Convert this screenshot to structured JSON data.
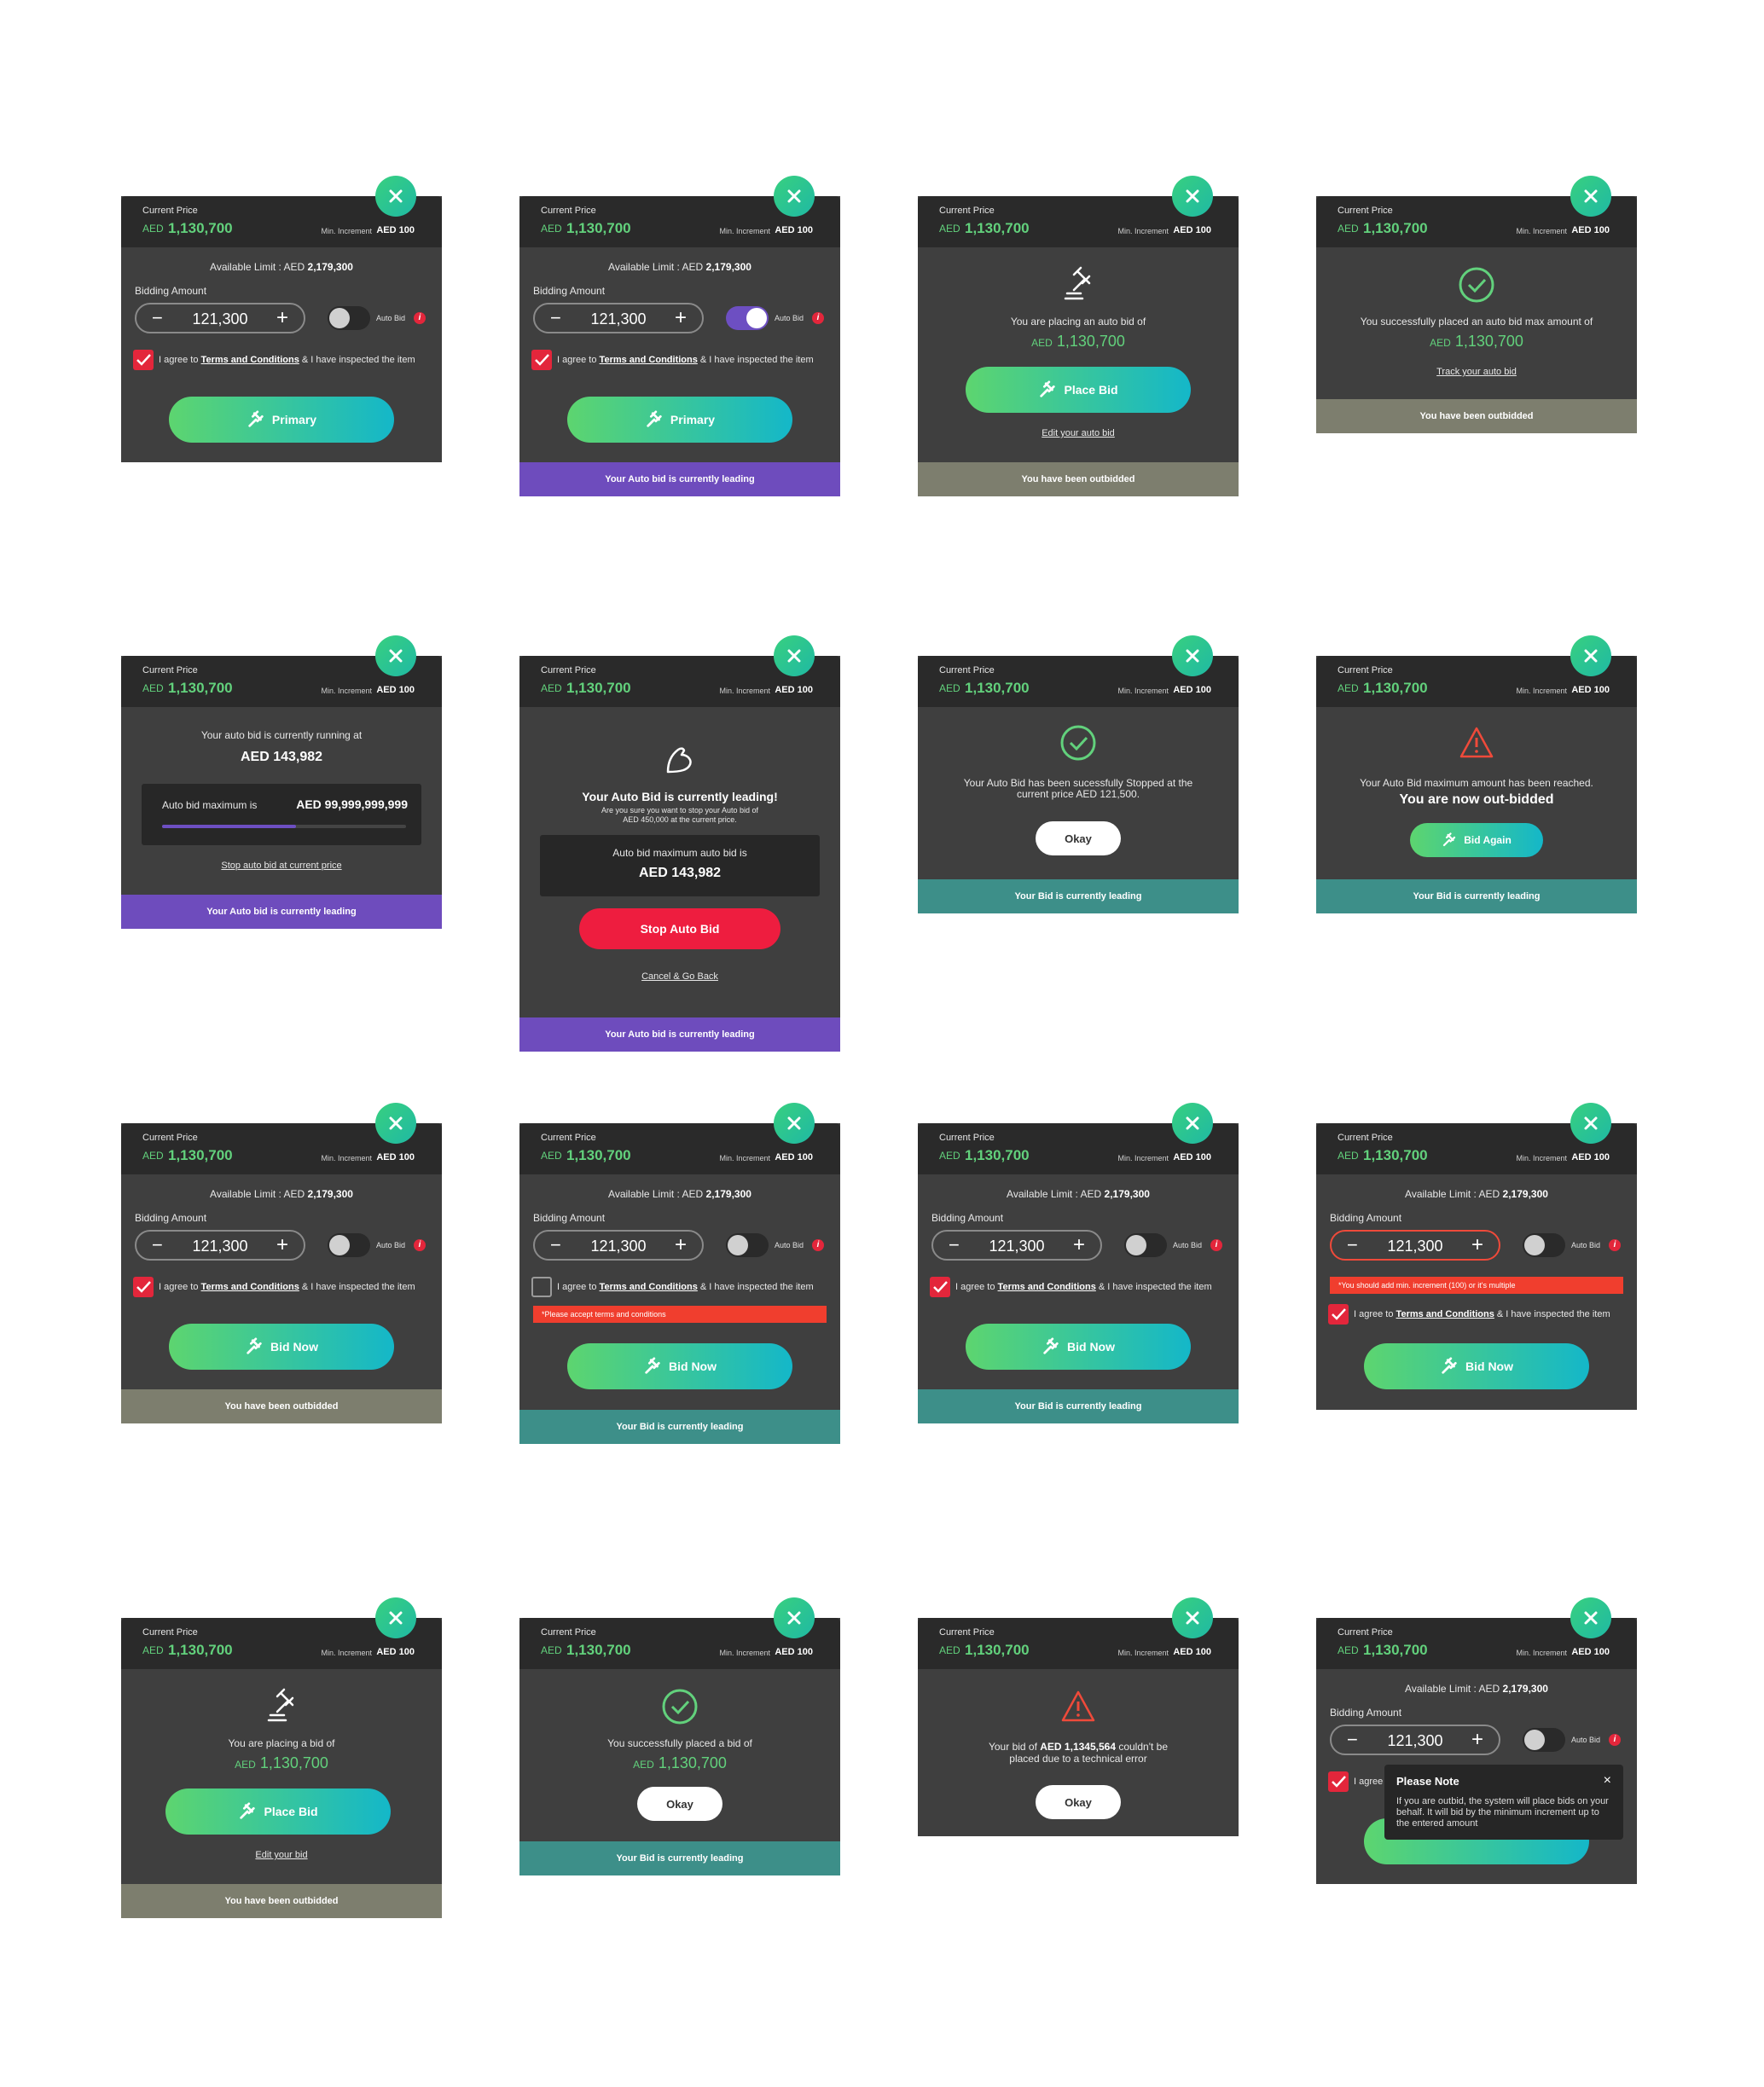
{
  "header": {
    "current_price_label": "Current Price",
    "currency": "AED",
    "price": "1,130,700",
    "min_increment_label": "Min. Increment",
    "min_increment_value": "AED 100"
  },
  "bid_form": {
    "available_limit_label": "Available Limit : AED ",
    "available_limit_value": "2,179,300",
    "bidding_amount_label": "Bidding Amount",
    "amount": "121,300",
    "minus": "−",
    "plus": "+",
    "auto_bid_label": "Auto Bid",
    "info_glyph": "i",
    "agree_prefix": "I agree to ",
    "terms_link": "Terms and Conditions",
    "agree_suffix": " & I have inspected the item",
    "terms_error": "*Please accept terms and conditions",
    "increment_error": "*You should add min. increment (100) or it's multiple"
  },
  "buttons": {
    "primary": "Primary",
    "place_bid": "Place Bid",
    "bid_now": "Bid Now",
    "bid_again": "Bid Again",
    "stop_auto_bid": "Stop Auto Bid",
    "okay": "Okay"
  },
  "footers": {
    "auto_leading": "Your Auto bid is currently leading",
    "outbidded": "You have been outbidded",
    "bid_leading": "Your Bid is currently leading"
  },
  "messages": {
    "placing_auto": "You are placing an auto bid of",
    "edit_auto": "Edit your auto bid",
    "success_auto": "You successfully placed an auto bid max amount of",
    "track_auto": "Track your auto bid",
    "running_at": "Your auto bid is currently running at",
    "running_value": "AED 143,982",
    "auto_max_label": "Auto bid maximum is",
    "auto_max_value": "AED 99,999,999,999",
    "auto_max_progress": 0.55,
    "stop_at_current": "Stop auto bid at current price",
    "leading_title": "Your Auto Bid is currently leading!",
    "leading_sub1": "Are you sure you want to stop your Auto bid of",
    "leading_sub2": "AED 450,000 at the current price.",
    "leading_max_label": "Auto bid maximum auto bid is",
    "leading_max_value": "AED 143,982",
    "cancel_back": "Cancel & Go Back",
    "stopped1": "Your Auto Bid has been sucessfully Stopped at the",
    "stopped2": "current price AED 121,500.",
    "max_reached": "Your Auto Bid maximum amount has been reached.",
    "out_bidded": "You are now out-bidded",
    "placing_bid": "You are placing a bid of",
    "edit_bid": "Edit your bid",
    "success_bid": "You successfully placed a bid of",
    "error_prefix": "Your bid of ",
    "error_amount": "AED 1,1345,564",
    "error_suffix": " couldn't be",
    "error_line2": "placed due to a technical error"
  },
  "note": {
    "title": "Please Note",
    "close": "×",
    "body": "If you are outbid, the system will place bids on your behalf. It will bid by the minimum increment up to the entered amount",
    "agree_partial": "I agree"
  },
  "colors": {
    "card_bg": "#3f3f3f",
    "header_bg": "#2a2a2a",
    "price_green": "#62d17c",
    "purple": "#6e4cbd",
    "olive": "#7d7e6e",
    "teal": "#3d8f89",
    "red": "#ee1d3f"
  }
}
